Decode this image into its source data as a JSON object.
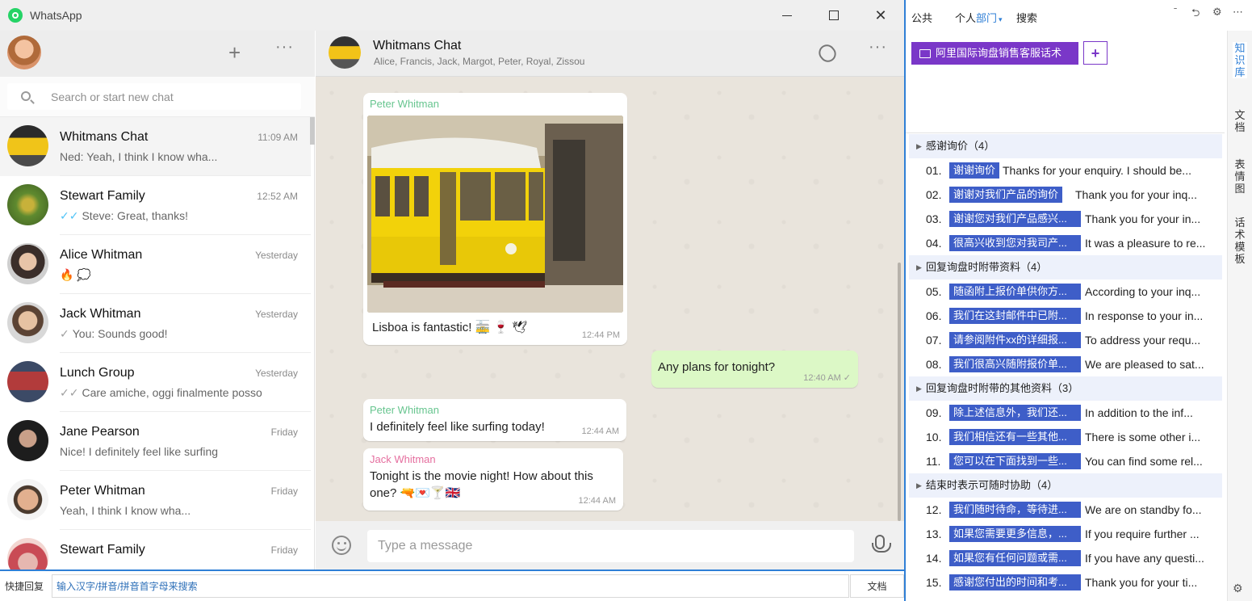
{
  "app": {
    "title": "WhatsApp"
  },
  "left": {
    "search_placeholder": "Search or start new chat",
    "new_chat_label": "+",
    "menu_label": "···",
    "chats": [
      {
        "name": "Whitmans Chat",
        "time": "11:09 AM",
        "preview": "Ned: Yeah, I think I know wha...",
        "tick": ""
      },
      {
        "name": "Stewart Family",
        "time": "12:52 AM",
        "preview": "Steve: Great, thanks!",
        "tick": "✓✓"
      },
      {
        "name": "Alice Whitman",
        "time": "Yesterday",
        "preview": "🔥 💭",
        "tick": ""
      },
      {
        "name": "Jack Whitman",
        "time": "Yesterday",
        "preview": "You: Sounds good!",
        "tick": "✓"
      },
      {
        "name": "Lunch Group",
        "time": "Yesterday",
        "preview": "Care amiche, oggi finalmente posso",
        "tick": "✓✓"
      },
      {
        "name": "Jane Pearson",
        "time": "Friday",
        "preview": "Nice! I definitely feel like surfing",
        "tick": ""
      },
      {
        "name": "Peter Whitman",
        "time": "Friday",
        "preview": "Yeah, I think I know wha...",
        "tick": ""
      },
      {
        "name": "Stewart Family",
        "time": "Friday",
        "preview": "",
        "tick": ""
      }
    ]
  },
  "conversation": {
    "title": "Whitmans Chat",
    "members": "Alice, Francis, Jack, Margot, Peter, Royal, Zissou",
    "menu_label": "···",
    "messages": [
      {
        "sender": "Peter Whitman",
        "text": "Lisboa is fantastic! 🚋 🍷 🕊",
        "time": "12:44 PM"
      },
      {
        "sender": "",
        "text": "Any plans for tonight?",
        "time": "12:40 AM ✓"
      },
      {
        "sender": "Peter Whitman",
        "text": "I definitely feel like surfing today!",
        "time": "12:44 AM"
      },
      {
        "sender": "Jack Whitman",
        "text": "Tonight is the movie night! How about this one? 🔫💌🍸🇬🇧",
        "time": "12:44 AM"
      }
    ],
    "composer_placeholder": "Type a message"
  },
  "quickbar": {
    "label": "快捷回复",
    "placeholder": "输入汉字/拼音/拼音首字母来搜索",
    "doc_button": "文档"
  },
  "kb": {
    "tabs": [
      "公共",
      "个人",
      "部门",
      "搜索"
    ],
    "active_tab_caret": "▾",
    "controls": [
      "ˉ",
      "⮌",
      "⚙",
      "⋯"
    ],
    "folder": "阿里国际询盘销售客服话术",
    "add_label": "+",
    "side_tabs": [
      "知识库",
      "文档",
      "表情图",
      "话术模板"
    ],
    "gear": "⚙",
    "categories": [
      {
        "title": "感谢询价（4）",
        "items": [
          {
            "num": "01.",
            "tag": "谢谢询价",
            "text": "Thanks for your enquiry. I should be..."
          },
          {
            "num": "02.",
            "tag": "谢谢对我们产品的询价",
            "text": "Thank you for your inq..."
          },
          {
            "num": "03.",
            "tag": "谢谢您对我们产品感兴...",
            "text": "Thank you for your in..."
          },
          {
            "num": "04.",
            "tag": "很高兴收到您对我司产...",
            "text": "It was a pleasure to re..."
          }
        ]
      },
      {
        "title": "回复询盘时附带资料（4）",
        "items": [
          {
            "num": "05.",
            "tag": "随函附上报价单供你方...",
            "text": "According to your inq..."
          },
          {
            "num": "06.",
            "tag": "我们在这封邮件中已附...",
            "text": "In response to your in..."
          },
          {
            "num": "07.",
            "tag": "请参阅附件xx的详细报...",
            "text": "To address your requ..."
          },
          {
            "num": "08.",
            "tag": "我们很高兴随附报价单...",
            "text": "We are pleased to sat..."
          }
        ]
      },
      {
        "title": "回复询盘时附带的其他资料（3）",
        "items": [
          {
            "num": "09.",
            "tag": "除上述信息外，我们还...",
            "text": "In addition to the inf..."
          },
          {
            "num": "10.",
            "tag": "我们相信还有一些其他...",
            "text": "There is some other i..."
          },
          {
            "num": "11.",
            "tag": "您可以在下面找到一些...",
            "text": "You can find some rel..."
          }
        ]
      },
      {
        "title": "结束时表示可随时协助（4）",
        "items": [
          {
            "num": "12.",
            "tag": "我们随时待命，等待进...",
            "text": "We are on standby fo..."
          },
          {
            "num": "13.",
            "tag": "如果您需要更多信息，...",
            "text": "If you require further ..."
          },
          {
            "num": "14.",
            "tag": "如果您有任何问题或需...",
            "text": "If you have any questi..."
          },
          {
            "num": "15.",
            "tag": "感谢您付出的时间和考...",
            "text": "Thank you for your ti..."
          }
        ]
      }
    ]
  }
}
